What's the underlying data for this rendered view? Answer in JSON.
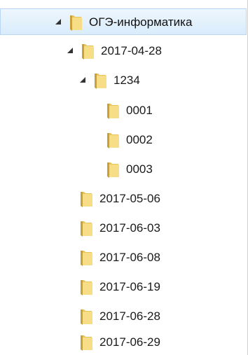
{
  "tree": {
    "root": {
      "label": "ОГЭ-информатика",
      "expanded": true,
      "selected": true
    },
    "level1": [
      {
        "label": "2017-04-28",
        "expanded": true,
        "children": [
          {
            "label": "1234",
            "expanded": true,
            "children": [
              {
                "label": "0001"
              },
              {
                "label": "0002"
              },
              {
                "label": "0003"
              }
            ]
          }
        ]
      },
      {
        "label": "2017-05-06"
      },
      {
        "label": "2017-06-03"
      },
      {
        "label": "2017-06-08"
      },
      {
        "label": "2017-06-19"
      },
      {
        "label": "2017-06-28"
      },
      {
        "label": "2017-06-29"
      }
    ]
  },
  "icons": {
    "folder": "folder-icon",
    "expanded_arrow": "expanded-arrow-icon"
  },
  "colors": {
    "selection_fill": "#d9ecfb",
    "selection_border": "#b8d6f4",
    "folder_yellow": "#f3d36b",
    "folder_dark": "#c9a13a"
  }
}
